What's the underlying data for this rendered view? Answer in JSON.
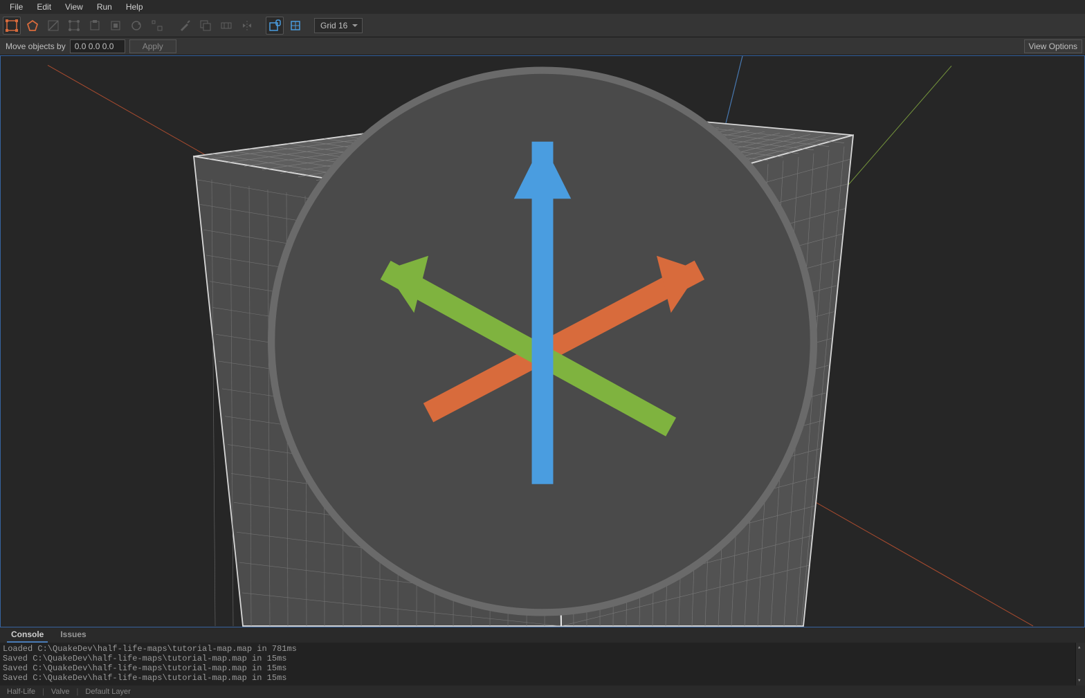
{
  "menu": {
    "items": [
      "File",
      "Edit",
      "View",
      "Run",
      "Help"
    ]
  },
  "toolbar": {
    "grid_label": "Grid 16"
  },
  "secondbar": {
    "move_label": "Move objects by",
    "move_value": "0.0 0.0 0.0",
    "apply_label": "Apply",
    "view_options_label": "View Options"
  },
  "bottom_tabs": {
    "console": "Console",
    "issues": "Issues"
  },
  "console_lines": [
    "Loaded C:\\QuakeDev\\half-life-maps\\tutorial-map.map in 781ms",
    "Saved C:\\QuakeDev\\half-life-maps\\tutorial-map.map in 15ms",
    "Saved C:\\QuakeDev\\half-life-maps\\tutorial-map.map in 15ms",
    "Saved C:\\QuakeDev\\half-life-maps\\tutorial-map.map in 15ms"
  ],
  "status": {
    "game": "Half-Life",
    "mod": "Valve",
    "layer": "Default Layer"
  },
  "colors": {
    "axis_x": "#d86b3c",
    "axis_y": "#7fb33f",
    "axis_z": "#4a7db8"
  }
}
